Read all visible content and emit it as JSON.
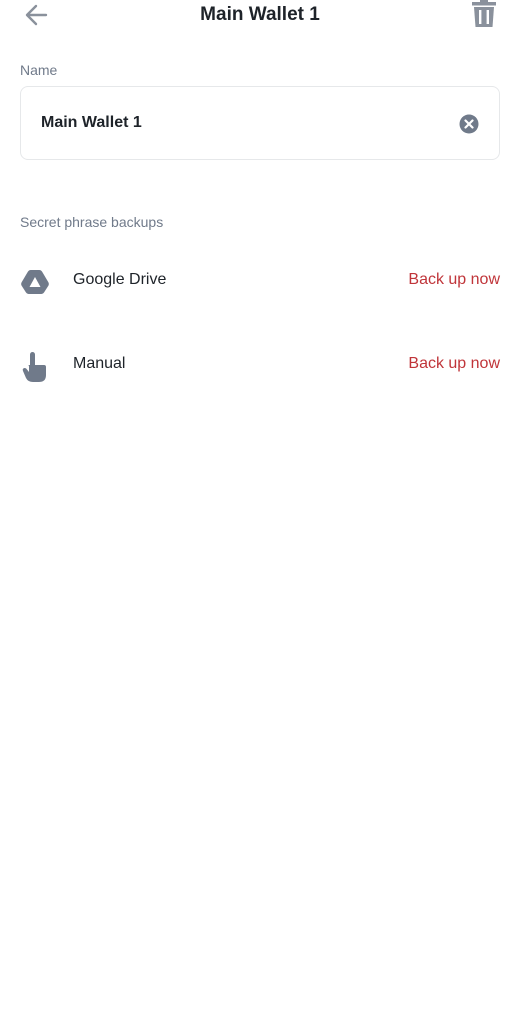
{
  "header": {
    "title": "Main Wallet 1",
    "back_icon": "arrow-left-icon",
    "delete_icon": "trash-icon"
  },
  "name_section": {
    "label": "Name",
    "value": "Main Wallet 1",
    "clear_icon": "clear-circle-icon"
  },
  "backups": {
    "label": "Secret phrase backups",
    "items": [
      {
        "label": "Google Drive",
        "icon": "google-drive-icon",
        "action": "Back up now"
      },
      {
        "label": "Manual",
        "icon": "hand-pointer-icon",
        "action": "Back up now"
      }
    ]
  },
  "colors": {
    "text": "#1e2329",
    "muted": "#707a8a",
    "icon": "#8a919c",
    "accent": "#c0353a",
    "border": "#e6e8ea"
  }
}
